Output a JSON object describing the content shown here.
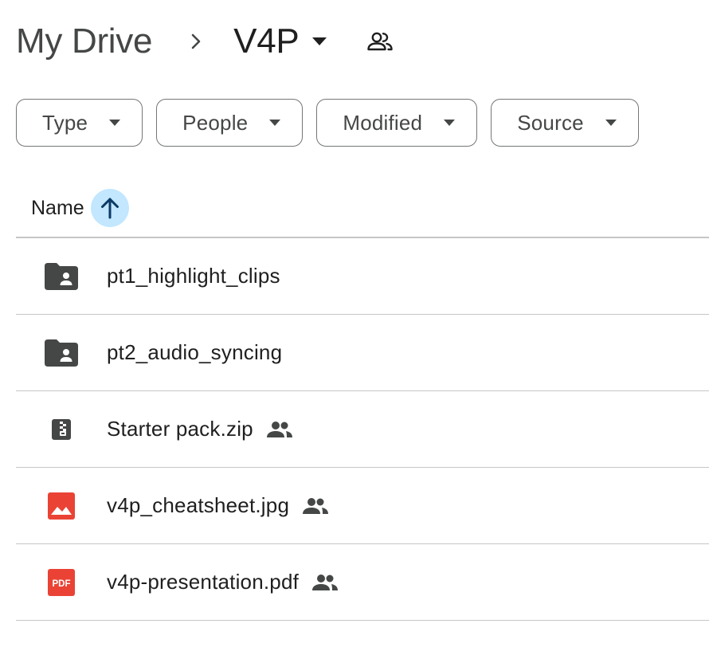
{
  "breadcrumb": {
    "root_label": "My Drive",
    "separator_icon": "chevron-right-icon",
    "current_label": "V4P",
    "caret_icon": "caret-down-icon",
    "shared_icon": "shared-folder-people-icon"
  },
  "filters": [
    {
      "label": "Type",
      "icon": "caret-down-icon"
    },
    {
      "label": "People",
      "icon": "caret-down-icon"
    },
    {
      "label": "Modified",
      "icon": "caret-down-icon"
    },
    {
      "label": "Source",
      "icon": "caret-down-icon"
    }
  ],
  "list_header": {
    "name_label": "Name",
    "sort_icon": "arrow-up-icon",
    "sort_direction": "ascending"
  },
  "files": [
    {
      "name": "pt1_highlight_clips",
      "type": "shared-folder",
      "icon": "shared-folder-icon",
      "shared": false
    },
    {
      "name": "pt2_audio_syncing",
      "type": "shared-folder",
      "icon": "shared-folder-icon",
      "shared": false
    },
    {
      "name": "Starter pack.zip",
      "type": "zip",
      "icon": "zip-file-icon",
      "shared": true
    },
    {
      "name": "v4p_cheatsheet.jpg",
      "type": "image",
      "icon": "image-file-icon",
      "shared": true
    },
    {
      "name": "v4p-presentation.pdf",
      "type": "pdf",
      "icon": "pdf-file-icon",
      "shared": true
    }
  ],
  "pdf_badge_text": "PDF",
  "colors": {
    "text_primary": "#1f1f1f",
    "text_secondary": "#444746",
    "icon_dark": "#444746",
    "sort_highlight": "#c2e7ff",
    "sort_arrow": "#0b3a66",
    "image_red": "#ea4335",
    "pdf_red": "#ea4335",
    "divider": "#c4c7c5"
  }
}
